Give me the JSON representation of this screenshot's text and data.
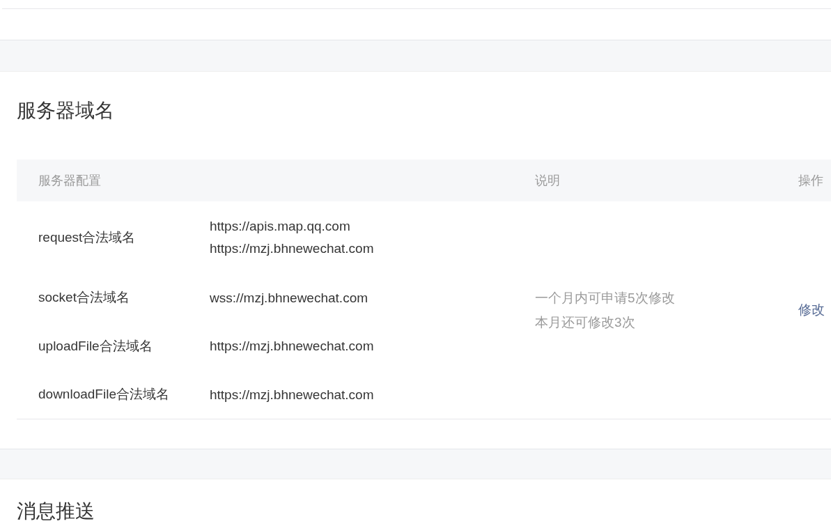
{
  "server_domain": {
    "title": "服务器域名",
    "columns": [
      "服务器配置",
      "说明",
      "操作"
    ],
    "rows": [
      {
        "label": "request合法域名",
        "domains": [
          "https://apis.map.qq.com",
          "https://mzj.bhnewechat.com"
        ]
      },
      {
        "label": "socket合法域名",
        "domains": [
          "wss://mzj.bhnewechat.com"
        ]
      },
      {
        "label": "uploadFile合法域名",
        "domains": [
          "https://mzj.bhnewechat.com"
        ]
      },
      {
        "label": "downloadFile合法域名",
        "domains": [
          "https://mzj.bhnewechat.com"
        ]
      }
    ],
    "notes": [
      "一个月内可申请5次修改",
      "本月还可修改3次"
    ],
    "action": "修改"
  },
  "message_push": {
    "title": "消息推送"
  }
}
